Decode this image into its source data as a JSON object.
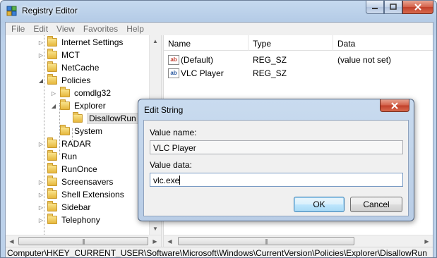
{
  "window": {
    "title": "Registry Editor"
  },
  "menu": [
    "File",
    "Edit",
    "View",
    "Favorites",
    "Help"
  ],
  "tree": [
    {
      "label": "Internet Settings",
      "arrow": "▷"
    },
    {
      "label": "MCT",
      "arrow": "▷"
    },
    {
      "label": "NetCache",
      "arrow": ""
    },
    {
      "label": "Policies",
      "arrow": "◢"
    },
    {
      "label": "comdlg32",
      "arrow": "▷"
    },
    {
      "label": "Explorer",
      "arrow": "◢"
    },
    {
      "label": "DisallowRun",
      "arrow": ""
    },
    {
      "label": "System",
      "arrow": ""
    },
    {
      "label": "RADAR",
      "arrow": "▷"
    },
    {
      "label": "Run",
      "arrow": ""
    },
    {
      "label": "RunOnce",
      "arrow": ""
    },
    {
      "label": "Screensavers",
      "arrow": "▷"
    },
    {
      "label": "Shell Extensions",
      "arrow": "▷"
    },
    {
      "label": "Sidebar",
      "arrow": "▷"
    },
    {
      "label": "Telephony",
      "arrow": "▷"
    }
  ],
  "list": {
    "columns": [
      "Name",
      "Type",
      "Data"
    ],
    "rows": [
      {
        "name": "(Default)",
        "type": "REG_SZ",
        "data": "(value not set)"
      },
      {
        "name": "VLC Player",
        "type": "REG_SZ",
        "data": ""
      }
    ]
  },
  "status_path": "Computer\\HKEY_CURRENT_USER\\Software\\Microsoft\\Windows\\CurrentVersion\\Policies\\Explorer\\DisallowRun",
  "dialog": {
    "title": "Edit String",
    "value_name_label": "Value name:",
    "value_name": "VLC Player",
    "value_data_label": "Value data:",
    "value_data": "vlc.exe",
    "ok_label": "OK",
    "cancel_label": "Cancel"
  },
  "icons": {
    "app": "registry-editor-icon",
    "reg_value": "reg-sz-icon",
    "folder": "folder-icon"
  }
}
